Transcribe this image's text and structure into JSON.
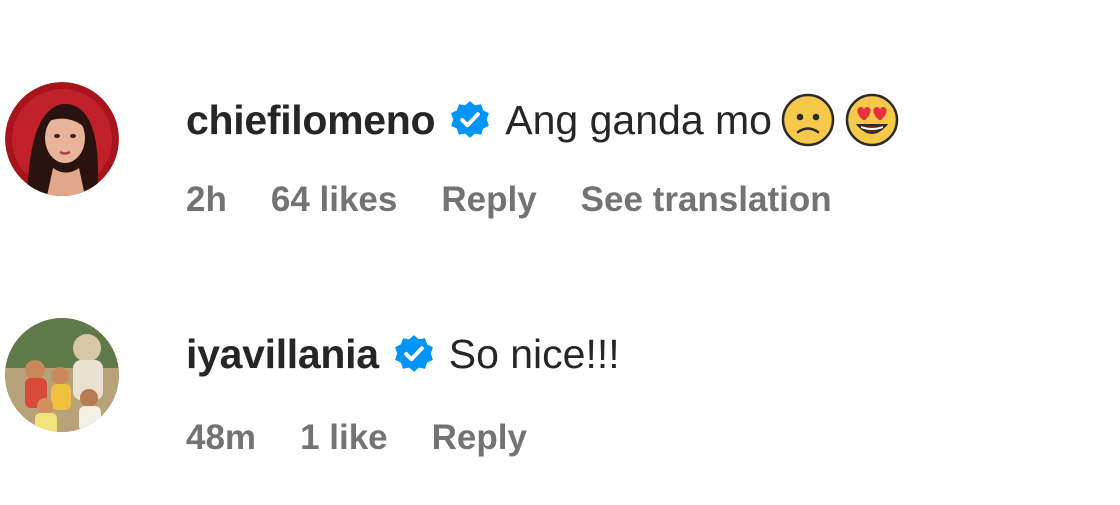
{
  "comments": [
    {
      "username": "chiefilomeno",
      "verified": true,
      "text": "Ang ganda mo",
      "emojis": [
        "sad-face-emoji",
        "heart-eyes-emoji"
      ],
      "time": "2h",
      "likes": "64 likes",
      "reply_label": "Reply",
      "translation_label": "See translation"
    },
    {
      "username": "iyavillania",
      "verified": true,
      "text": "So nice!!!",
      "time": "48m",
      "likes": "1 like",
      "reply_label": "Reply"
    }
  ],
  "colors": {
    "verified_badge": "#0095f6",
    "meta_text": "#737373",
    "primary_text": "#262626"
  }
}
